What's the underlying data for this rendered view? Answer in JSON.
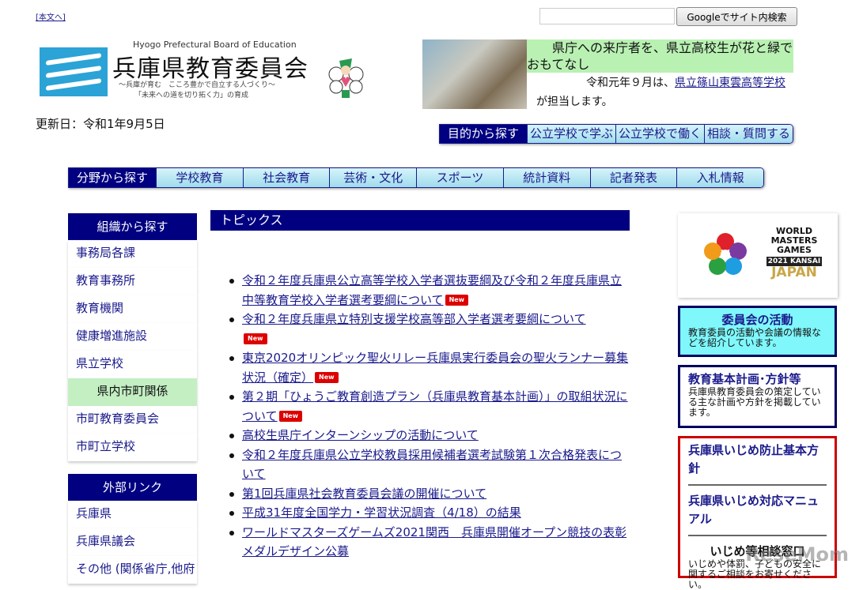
{
  "skip_link": "[本文へ]",
  "search": {
    "placeholder": "",
    "button": "Googleでサイト内検索"
  },
  "logo": {
    "en": "Hyogo Prefectural Board of Education",
    "jp": "兵庫県教育委員会",
    "sub1": "～兵庫が育む　こころ豊かで自立する人づくり～",
    "sub2": "「未来への道を切り拓く力」の育成"
  },
  "updated": "更新日：令和1年9月5日",
  "banner": {
    "title": "県庁への来庁者を、県立高校生が花と緑でおもてなし",
    "body_pre": "令和元年９月は、",
    "link": "県立篠山東雲高等学校",
    "body_post": "が担当します。"
  },
  "purpose_nav": {
    "label": "目的から探す",
    "items": [
      "公立学校で学ぶ",
      "公立学校で働く",
      "相談・質問する"
    ]
  },
  "field_nav": {
    "label": "分野から探す",
    "items": [
      "学校教育",
      "社会教育",
      "芸術・文化",
      "スポーツ",
      "統計資料",
      "記者発表",
      "入札情報"
    ]
  },
  "sidebar": {
    "org_title": "組織から探す",
    "org_items": [
      "事務局各課",
      "教育事務所",
      "教育機関",
      "健康増進施設",
      "県立学校"
    ],
    "city_title": "県内市町関係",
    "city_items": [
      "市町教育委員会",
      "市町立学校"
    ],
    "ext_title": "外部リンク",
    "ext_items": [
      "兵庫県",
      "兵庫県議会",
      "その他 (関係省庁,他府"
    ]
  },
  "topics": {
    "title": "トピックス",
    "new_label": "New",
    "items": [
      "令和２年度兵庫県公立高等学校入学者選抜要綱及び令和２年度兵庫県立中等教育学校入学者選考要綱について",
      "令和２年度兵庫県立特別支援学校高等部入学者選考要綱について",
      "東京2020オリンピック聖火リレー兵庫県実行委員会の聖火ランナー募集状況（確定）",
      "第２期「ひょうご教育創造プラン（兵庫県教育基本計画）」の取組状況について",
      "高校生県庁インターンシップの活動について",
      "令和２年度兵庫県公立学校教員採用候補者選考試験第１次合格発表について",
      "第1回兵庫県社会教育委員会議の開催について",
      "平成31年度全国学力・学習状況調査（4/18）の結果",
      "ワールドマスターズゲームズ2021関西　兵庫県開催オープン競技の表彰メダルデザイン公募"
    ]
  },
  "wmg": {
    "l1": "WORLD",
    "l2": "MASTERS",
    "l3": "GAMES",
    "l4": "2021 KANSAI",
    "l5": "JAPAN"
  },
  "activities": {
    "title": "委員会の活動",
    "desc": "教育委員の活動や会議の情報などを紹介しています。"
  },
  "plan": {
    "title": "教育基本計画･方針等",
    "desc": "兵庫県教育委員会の策定している主な計画や方針を掲載しています。"
  },
  "bullying": {
    "link1": "兵庫県いじめ防止基本方針",
    "link2": "兵庫県いじめ対応マニュアル",
    "consult_title": "いじめ等相談窓口",
    "consult_desc": "いじめや体罰、子どもの安全に関するご相談をお寄せください。"
  },
  "watermark": "ReseMom"
}
